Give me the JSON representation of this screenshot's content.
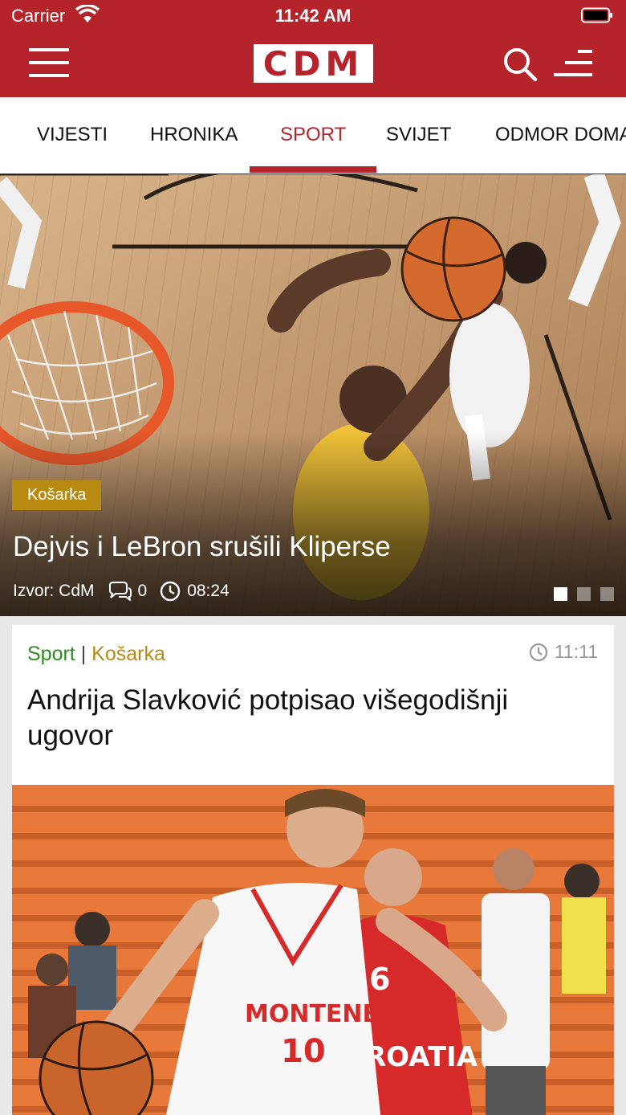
{
  "status_bar": {
    "carrier": "Carrier",
    "time": "11:42 AM"
  },
  "header": {
    "logo": "CDM"
  },
  "tabs": [
    {
      "label": "VIJESTI"
    },
    {
      "label": "HRONIKA"
    },
    {
      "label": "SPORT"
    },
    {
      "label": "SVIJET"
    },
    {
      "label": "ODMOR DOMA"
    }
  ],
  "hero": {
    "category": "Košarka",
    "title": "Dejvis i LeBron srušili Kliperse",
    "source": "Izvor: CdM",
    "comments": "0",
    "time": "08:24"
  },
  "article": {
    "category": "Sport",
    "separator": "|",
    "subcategory": "Košarka",
    "time": "11:11",
    "title": "Andrija Slavković potpisao višegodišnji ugovor"
  },
  "colors": {
    "brand": "#b5242a",
    "badge": "#b98a12",
    "category_green": "#2e8b22"
  }
}
